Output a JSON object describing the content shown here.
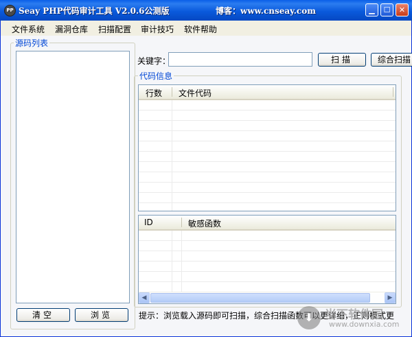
{
  "window": {
    "title": "Seay PHP代码审计工具 V2.0.6公测版",
    "blog": "博客：www.cnseay.com",
    "app_icon": "PP",
    "controls": {
      "minimize": "▁",
      "maximize": "☐",
      "close": "✕"
    }
  },
  "menu": [
    "文件系统",
    "漏洞仓库",
    "扫描配置",
    "审计技巧",
    "软件帮助"
  ],
  "source_list": {
    "label": "源码列表",
    "clear_button": "清空",
    "browse_button": "浏览"
  },
  "search": {
    "keyword_label": "关键字：",
    "keyword_value": "",
    "scan_button": "扫描",
    "combined_scan_button": "综合扫描"
  },
  "code_info": {
    "label": "代码信息",
    "columns": [
      "行数",
      "文件代码"
    ]
  },
  "sensitive_grid": {
    "columns": [
      "ID",
      "敏感函数"
    ]
  },
  "tip": "提示：浏览载入源码即可扫描，综合扫描函数可以更详细，正则模式更",
  "watermark": {
    "text": "当下软件园",
    "domain": "www.downxia.com"
  },
  "colors": {
    "title_bar": "#0a5adc",
    "group_label": "#0046d5",
    "window_bg": "#f5f6f9"
  }
}
